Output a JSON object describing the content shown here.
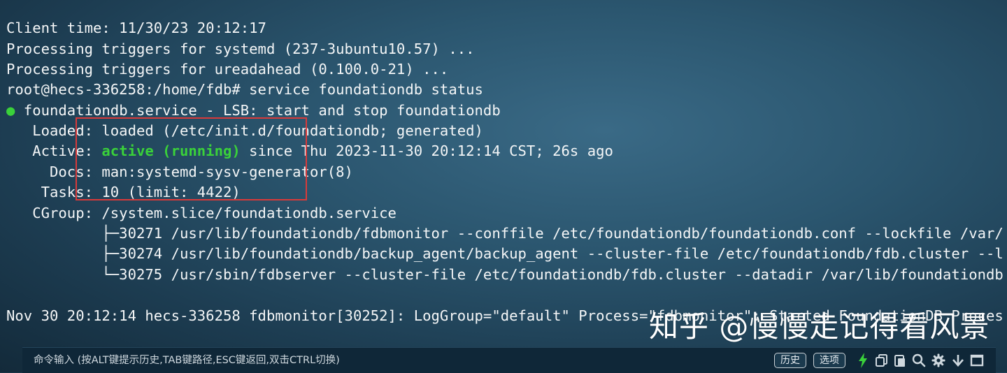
{
  "terminal": {
    "lines": {
      "l1": "Client time: 11/30/23 20:12:17",
      "l2": "Processing triggers for systemd (237-3ubuntu10.57) ...",
      "l3": "Processing triggers for ureadahead (0.100.0-21) ...",
      "l4": "root@hecs-336258:/home/fdb# service foundationdb status",
      "l5_dot": "●",
      "l5": " foundationdb.service - LSB: start and stop foundationdb",
      "l6": "   Loaded: loaded (/etc/init.d/foundationdb; generated)",
      "l7_pre": "   Active: ",
      "l7_status": "active (running)",
      "l7_post": " since Thu 2023-11-30 20:12:14 CST; 26s ago",
      "l8": "     Docs: man:systemd-sysv-generator(8)",
      "l9": "    Tasks: 10 (limit: 4422)",
      "l10": "   CGroup: /system.slice/foundationdb.service",
      "l11": "           ├─30271 /usr/lib/foundationdb/fdbmonitor --conffile /etc/foundationdb/foundationdb.conf --lockfile /var/",
      "l12": "           ├─30274 /usr/lib/foundationdb/backup_agent/backup_agent --cluster-file /etc/foundationdb/fdb.cluster --l",
      "l13": "           └─30275 /usr/sbin/fdbserver --cluster-file /etc/foundationdb/fdb.cluster --datadir /var/lib/foundationdb",
      "l14": "Nov 30 20:12:14 hecs-336258 fdbmonitor[30252]: LogGroup=\"default\" Process=\"fdbmonitor\": Started FoundationDB Proces"
    },
    "text_color": "#f4f6f7",
    "active_color": "#3ad13a"
  },
  "watermark": {
    "text": "知乎 @慢慢走记得看风景"
  },
  "command_bar": {
    "placeholder": "命令输入 (按ALT键提示历史,TAB键路径,ESC键返回,双击CTRL切换)",
    "history_label": "历史",
    "options_label": "选项",
    "icons": [
      "lightning-icon",
      "copy-icon",
      "paste-icon",
      "search-icon",
      "gear-icon",
      "download-icon",
      "maximize-icon"
    ]
  },
  "highlight_color": "#d93a3a"
}
